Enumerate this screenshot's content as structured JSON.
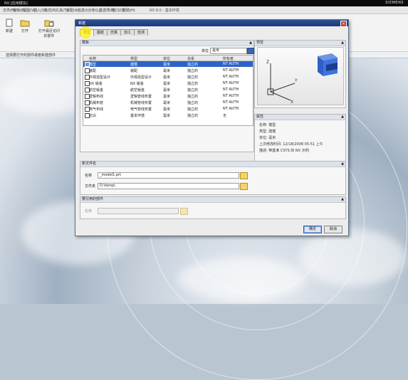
{
  "titlebar": {
    "title": "NX [应用模块]",
    "brand": "SIEMENS"
  },
  "menubar": {
    "items": [
      "文件(F)",
      "编辑(E)",
      "视图(V)",
      "插入(S)",
      "格式(R)",
      "工具(T)",
      "装配(A)",
      "信息(I)",
      "分析(L)",
      "首选项(P)",
      "窗口(O)",
      "帮助(H)"
    ],
    "version": "NX 8.0 - 基本环境"
  },
  "toolbar": {
    "buttons": [
      {
        "label": "新建"
      },
      {
        "label": "打开"
      },
      {
        "label": "打开最近访问的部件"
      }
    ]
  },
  "statusline": {
    "text": "选择要打开的部件或者新建部件"
  },
  "dialog": {
    "title": "新建",
    "close_glyph": "×",
    "tabs": [
      "模型",
      "图纸",
      "仿真",
      "加工",
      "检测"
    ],
    "templates": {
      "title": "模板",
      "filter_label": "单位",
      "filter_value": "毫米",
      "columns": [
        "名称",
        "类型",
        "单位",
        "关系",
        "所有者"
      ],
      "rows": [
        {
          "name": "模型",
          "type": "建模",
          "unit": "毫米",
          "rel": "独立的",
          "owner": "NT AUTH",
          "selected": true
        },
        {
          "name": "装配",
          "type": "装配",
          "unit": "毫米",
          "rel": "独立的",
          "owner": "NT AUTH"
        },
        {
          "name": "外观造型设计",
          "type": "外观造型设计",
          "unit": "毫米",
          "rel": "独立的",
          "owner": "NT AUTH"
        },
        {
          "name": "NX 钣金",
          "type": "NX 钣金",
          "unit": "毫米",
          "rel": "独立的",
          "owner": "NT AUTH"
        },
        {
          "name": "航空钣金",
          "type": "航空钣金",
          "unit": "毫米",
          "rel": "独立的",
          "owner": "NT AUTH"
        },
        {
          "name": "逻辑布线",
          "type": "逻辑管线布置",
          "unit": "毫米",
          "rel": "独立的",
          "owner": "NT AUTH"
        },
        {
          "name": "机械布管",
          "type": "机械管线布置",
          "unit": "毫米",
          "rel": "独立的",
          "owner": "NT AUTH"
        },
        {
          "name": "电气布线",
          "type": "电气管线布置",
          "unit": "毫米",
          "rel": "独立的",
          "owner": "NT AUTH"
        },
        {
          "name": "空白",
          "type": "基本环境",
          "unit": "毫米",
          "rel": "独立的",
          "owner": "无"
        }
      ]
    },
    "preview": {
      "title": "预览"
    },
    "properties": {
      "title": "属性",
      "lines": [
        "名称: 模型",
        "类型: 建模",
        "单位: 毫米",
        "上次修改时间: 12/18/2008 05:51 上午",
        "描述: 带基准 CSYS 的 NX 示例"
      ]
    },
    "new_file": {
      "title": "新文件名",
      "name_label": "名称",
      "name_value": "_model1.prt",
      "folder_label": "文件夹",
      "folder_value": "D:\\temp\\"
    },
    "parts": {
      "title": "要引用的部件",
      "name_label": "名称"
    },
    "buttons": {
      "ok": "确定",
      "cancel": "取消"
    }
  }
}
